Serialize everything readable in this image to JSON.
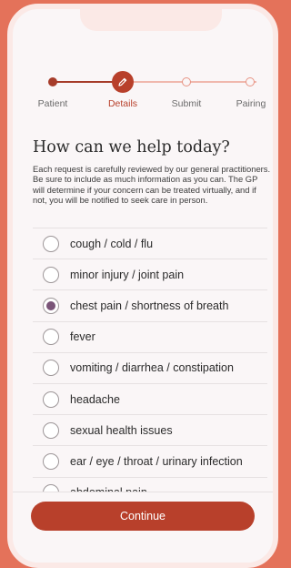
{
  "stepper": {
    "steps": [
      {
        "label": "Patient",
        "state": "done"
      },
      {
        "label": "Details",
        "state": "current"
      },
      {
        "label": "Submit",
        "state": "upcoming"
      },
      {
        "label": "Pairing",
        "state": "upcoming"
      }
    ],
    "current_icon": "pencil-icon"
  },
  "page": {
    "title": "How can we help today?",
    "intro": "Each request is carefully reviewed by our general practitioners. Be sure to include as much information as you can. The GP will determine if your concern can be treated virtually, and if not, you will be notified to seek care in person."
  },
  "options": [
    {
      "label": "cough / cold / flu",
      "selected": false
    },
    {
      "label": "minor injury / joint pain",
      "selected": false
    },
    {
      "label": "chest pain / shortness of breath",
      "selected": true
    },
    {
      "label": "fever",
      "selected": false
    },
    {
      "label": "vomiting / diarrhea / constipation",
      "selected": false
    },
    {
      "label": "headache",
      "selected": false
    },
    {
      "label": "sexual health issues",
      "selected": false
    },
    {
      "label": "ear / eye / throat / urinary infection",
      "selected": false
    },
    {
      "label": "abdominal pain",
      "selected": false
    }
  ],
  "footer": {
    "continue_label": "Continue"
  },
  "colors": {
    "background": "#e4725a",
    "accent": "#b8402b",
    "selected_radio": "#7a5478",
    "screen": "#faf6f7"
  }
}
